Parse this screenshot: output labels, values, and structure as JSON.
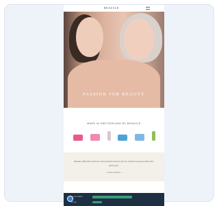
{
  "header": {
    "logo": "BEAUCLE",
    "menu_icon": "hamburger-menu-icon"
  },
  "hero": {
    "title": "PASSION FOR BEAUTY"
  },
  "products": {
    "title": "MADE IN SWITZERLAND BY BEAUCLE",
    "items": [
      {
        "color": "#e85a8f"
      },
      {
        "color": "#f08ab0"
      },
      {
        "color": "#d9c7d2"
      },
      {
        "color": "#4da3d9"
      },
      {
        "color": "#7fb8e6"
      },
      {
        "color": "#8fbf5a"
      }
    ]
  },
  "testimonial": {
    "quote": "Beauté, efficacité, douceur. Des produits suisses qui me rendent ma peau belle jour après jour.",
    "author": "— Maria Schiller —"
  },
  "cookie": {
    "text": "We use cookies",
    "links": "Settings"
  },
  "chat": {
    "icon": "chat-icon"
  }
}
